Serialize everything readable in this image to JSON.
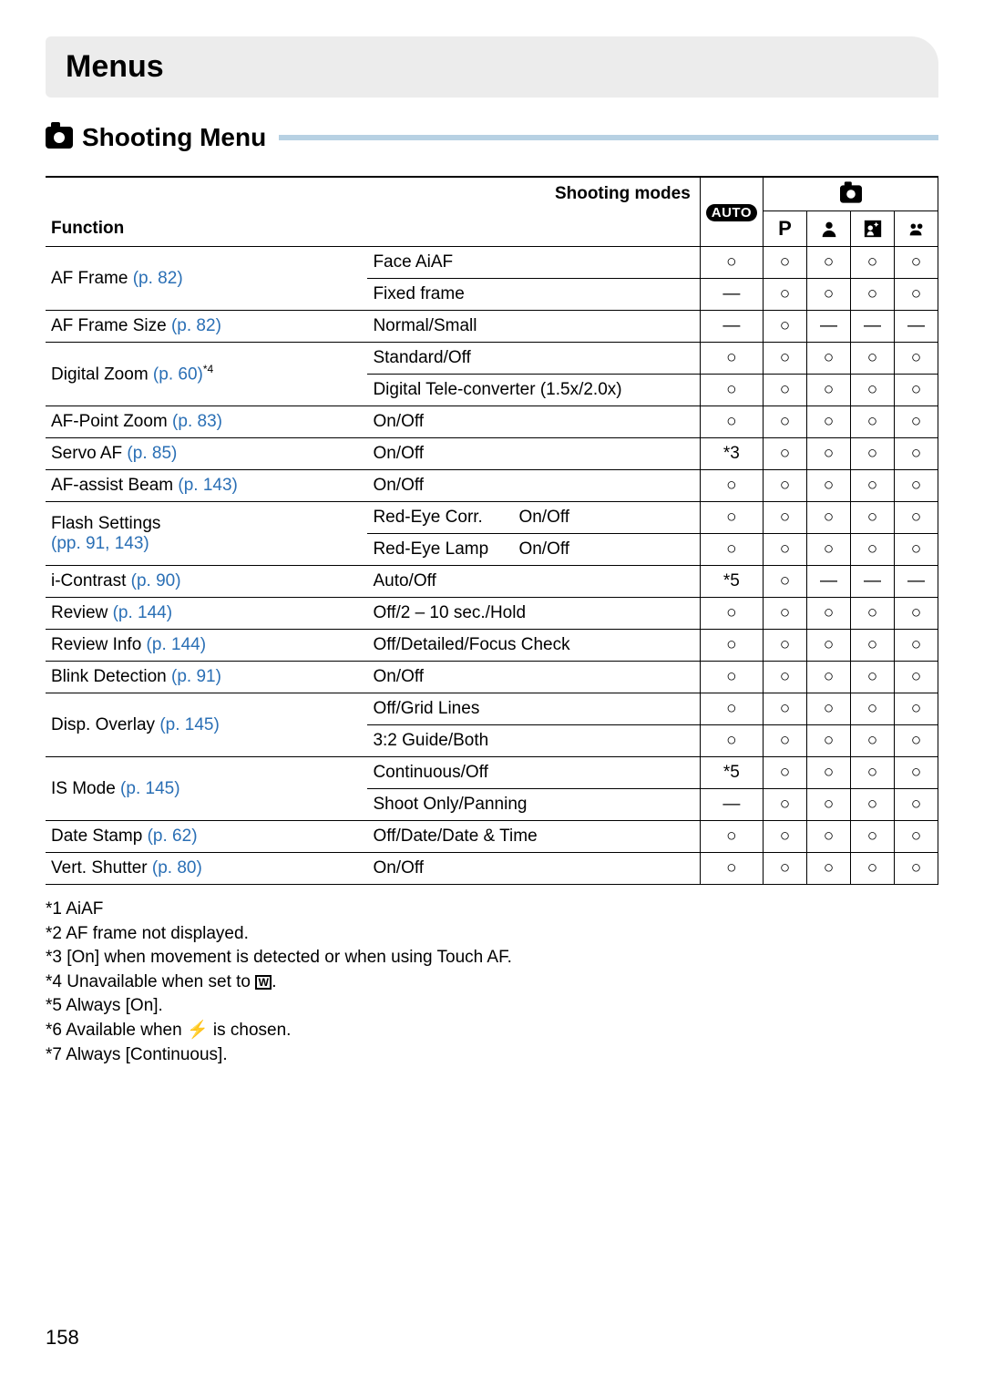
{
  "title": "Menus",
  "section": "Shooting Menu",
  "header": {
    "shooting_modes_label": "Shooting modes",
    "function_label": "Function",
    "auto_label": "AUTO"
  },
  "modes": [
    "P",
    "portrait",
    "night-snapshot",
    "kids-pets"
  ],
  "rows": [
    {
      "func": "AF Frame",
      "ref": "(p. 82)",
      "sup": "",
      "opts": [
        "Face AiAF",
        "Fixed frame"
      ],
      "vals": [
        [
          "○",
          "○",
          "○",
          "○",
          "○"
        ],
        [
          "—",
          "○",
          "○",
          "○",
          "○"
        ]
      ]
    },
    {
      "func": "AF Frame Size",
      "ref": "(p. 82)",
      "sup": "",
      "opts": [
        "Normal/Small"
      ],
      "vals": [
        [
          "—",
          "○",
          "—",
          "—",
          "—"
        ]
      ]
    },
    {
      "func": "Digital Zoom",
      "ref": "(p. 60)",
      "sup": "*4",
      "opts": [
        "Standard/Off",
        "Digital Tele-converter (1.5x/2.0x)"
      ],
      "vals": [
        [
          "○",
          "○",
          "○",
          "○",
          "○"
        ],
        [
          "○",
          "○",
          "○",
          "○",
          "○"
        ]
      ]
    },
    {
      "func": "AF-Point Zoom",
      "ref": "(p. 83)",
      "sup": "",
      "opts": [
        "On/Off"
      ],
      "vals": [
        [
          "○",
          "○",
          "○",
          "○",
          "○"
        ]
      ]
    },
    {
      "func": "Servo AF",
      "ref": "(p. 85)",
      "sup": "",
      "opts": [
        "On/Off"
      ],
      "vals": [
        [
          "*3",
          "○",
          "○",
          "○",
          "○"
        ]
      ]
    },
    {
      "func": "AF-assist Beam",
      "ref": "(p. 143)",
      "sup": "",
      "opts": [
        "On/Off"
      ],
      "vals": [
        [
          "○",
          "○",
          "○",
          "○",
          "○"
        ]
      ]
    },
    {
      "func": "Flash Settings",
      "func2": "",
      "ref": "(pp. 91, 143)",
      "sup": "",
      "opts": [
        "Red-Eye Corr.",
        "Red-Eye Lamp"
      ],
      "sub": [
        "On/Off",
        "On/Off"
      ],
      "vals": [
        [
          "○",
          "○",
          "○",
          "○",
          "○"
        ],
        [
          "○",
          "○",
          "○",
          "○",
          "○"
        ]
      ]
    },
    {
      "func": "i-Contrast",
      "ref": "(p. 90)",
      "sup": "",
      "opts": [
        "Auto/Off"
      ],
      "vals": [
        [
          "*5",
          "○",
          "—",
          "—",
          "—"
        ]
      ]
    },
    {
      "func": "Review",
      "ref": "(p. 144)",
      "sup": "",
      "opts": [
        "Off/2 – 10 sec./Hold"
      ],
      "vals": [
        [
          "○",
          "○",
          "○",
          "○",
          "○"
        ]
      ]
    },
    {
      "func": "Review Info",
      "ref": "(p. 144)",
      "sup": "",
      "opts": [
        "Off/Detailed/Focus Check"
      ],
      "vals": [
        [
          "○",
          "○",
          "○",
          "○",
          "○"
        ]
      ]
    },
    {
      "func": "Blink Detection",
      "ref": "(p. 91)",
      "sup": "",
      "opts": [
        "On/Off"
      ],
      "vals": [
        [
          "○",
          "○",
          "○",
          "○",
          "○"
        ]
      ]
    },
    {
      "func": "Disp. Overlay",
      "ref": "(p. 145)",
      "sup": "",
      "opts": [
        "Off/Grid Lines",
        "3:2 Guide/Both"
      ],
      "vals": [
        [
          "○",
          "○",
          "○",
          "○",
          "○"
        ],
        [
          "○",
          "○",
          "○",
          "○",
          "○"
        ]
      ]
    },
    {
      "func": "IS Mode",
      "ref": "(p. 145)",
      "sup": "",
      "opts": [
        "Continuous/Off",
        "Shoot Only/Panning"
      ],
      "vals": [
        [
          "*5",
          "○",
          "○",
          "○",
          "○"
        ],
        [
          "—",
          "○",
          "○",
          "○",
          "○"
        ]
      ]
    },
    {
      "func": "Date Stamp",
      "ref": "(p. 62)",
      "sup": "",
      "opts": [
        "Off/Date/Date & Time"
      ],
      "vals": [
        [
          "○",
          "○",
          "○",
          "○",
          "○"
        ]
      ]
    },
    {
      "func": "Vert. Shutter",
      "ref": "(p. 80)",
      "sup": "",
      "opts": [
        "On/Off"
      ],
      "vals": [
        [
          "○",
          "○",
          "○",
          "○",
          "○"
        ]
      ]
    }
  ],
  "footnotes": [
    "*1 AiAF",
    "*2 AF frame not displayed.",
    "*3 [On] when movement is detected or when using Touch AF.",
    "*4 Unavailable when set to ",
    "*5 Always [On].",
    "*6 Available when ",
    "*7 Always [Continuous]."
  ],
  "footnote_tail": {
    "4": ".",
    "6": " is chosen."
  },
  "page_number": "158"
}
